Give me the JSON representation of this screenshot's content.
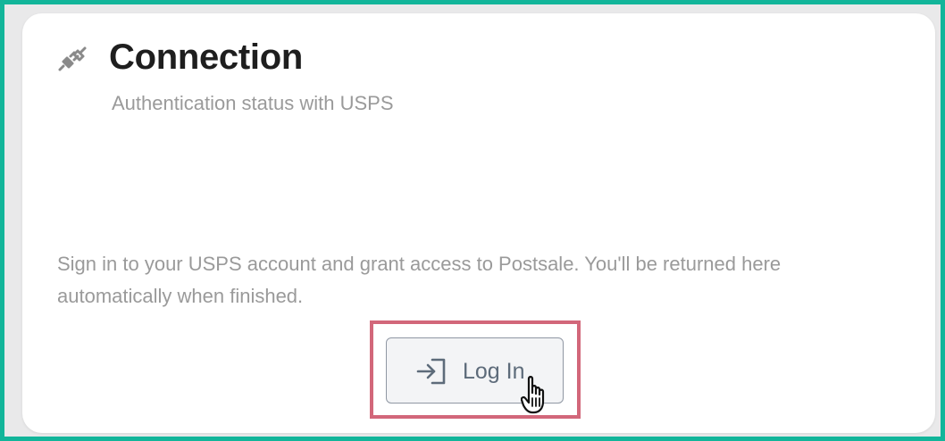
{
  "card": {
    "title": "Connection",
    "subtitle": "Authentication status with USPS",
    "description": "Sign in to your USPS account and grant access to Postsale. You'll be returned here automatically when finished.",
    "header_icon": "plug-disconnected-icon"
  },
  "login_button": {
    "label": "Log In",
    "icon": "sign-in-icon"
  },
  "cursor": {
    "icon": "hand-pointer-icon"
  },
  "colors": {
    "frame_border": "#12b59a",
    "highlight_border": "#d2677a",
    "title_text": "#1e1e1e",
    "muted_text": "#9a9a9a",
    "button_text": "#5d6b7a",
    "button_border": "#8f97a3",
    "button_background": "#f3f4f6"
  }
}
